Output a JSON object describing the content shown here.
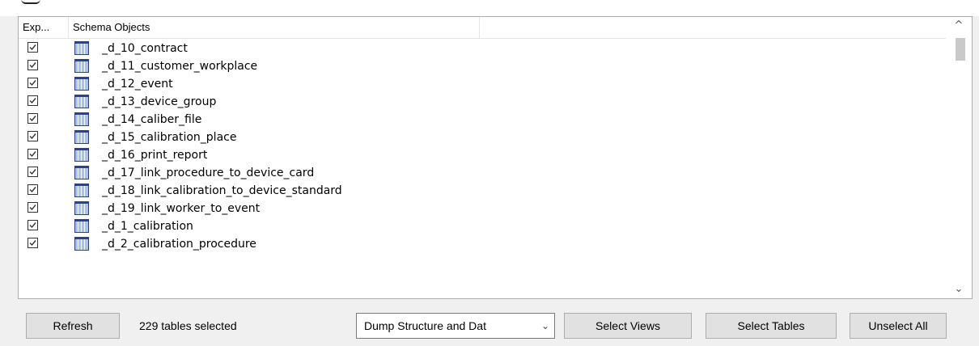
{
  "table": {
    "columns": [
      "Exp...",
      "Schema Objects"
    ],
    "rows": [
      {
        "checked": true,
        "name": "_d_10_contract"
      },
      {
        "checked": true,
        "name": "_d_11_customer_workplace"
      },
      {
        "checked": true,
        "name": "_d_12_event"
      },
      {
        "checked": true,
        "name": "_d_13_device_group"
      },
      {
        "checked": true,
        "name": "_d_14_caliber_file"
      },
      {
        "checked": true,
        "name": "_d_15_calibration_place"
      },
      {
        "checked": true,
        "name": "_d_16_print_report"
      },
      {
        "checked": true,
        "name": "_d_17_link_procedure_to_device_card"
      },
      {
        "checked": true,
        "name": "_d_18_link_calibration_to_device_standard"
      },
      {
        "checked": true,
        "name": "_d_19_link_worker_to_event"
      },
      {
        "checked": true,
        "name": "_d_1_calibration"
      },
      {
        "checked": true,
        "name": "_d_2_calibration_procedure"
      }
    ]
  },
  "icons": {
    "row_icon": "table-icon",
    "scroll_up": "chevron-up-icon",
    "scroll_down": "chevron-down-icon",
    "combo_arrow": "chevron-down-icon"
  },
  "toolbar": {
    "refresh_label": "Refresh",
    "status_text": "229 tables selected",
    "dump_mode_selected": "Dump Structure and Dat",
    "select_views_label": "Select Views",
    "select_tables_label": "Select Tables",
    "unselect_all_label": "Unselect All"
  }
}
